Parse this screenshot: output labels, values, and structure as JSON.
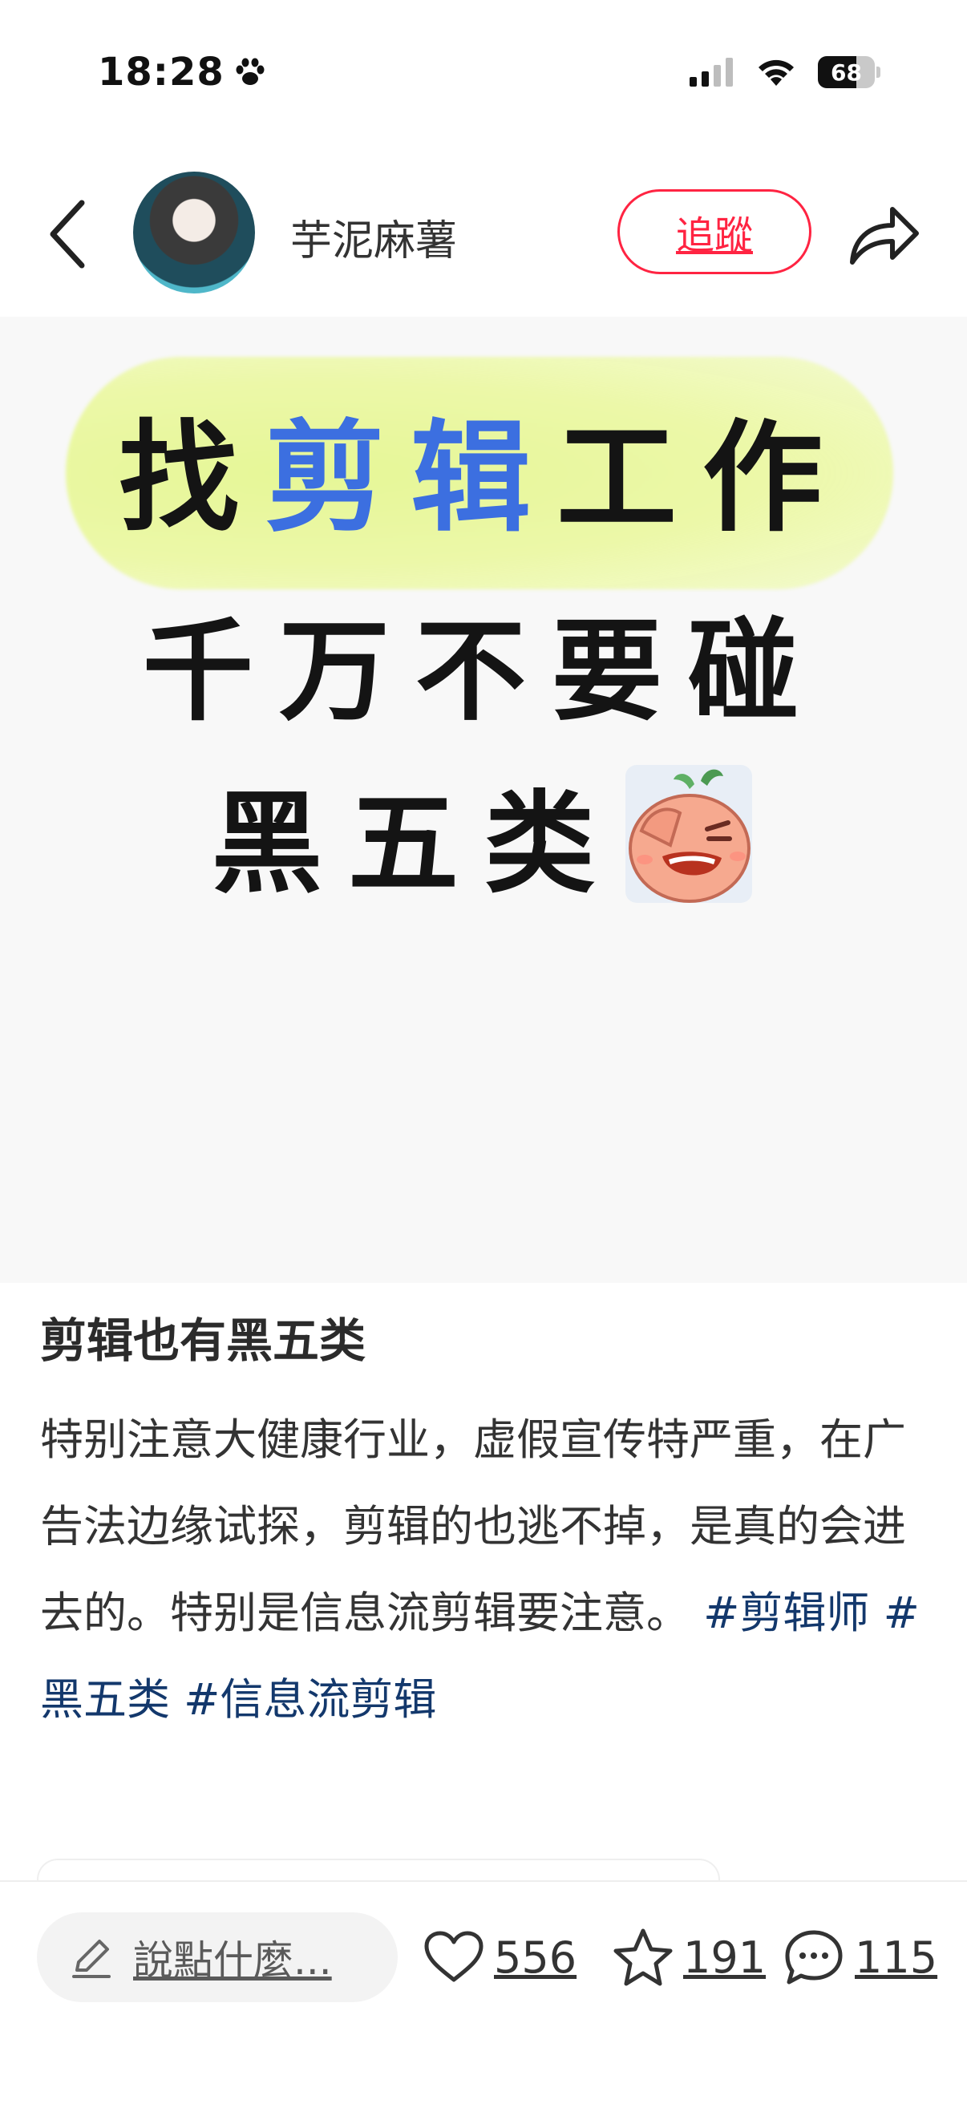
{
  "status_bar": {
    "time": "18:28",
    "battery_level": "68",
    "battery_fraction": 0.68,
    "icons": [
      "paw-icon",
      "signal-icon",
      "wifi-icon",
      "battery-icon"
    ]
  },
  "header": {
    "username": "芋泥麻薯",
    "follow_label": "追蹤",
    "icons": [
      "back-icon",
      "avatar",
      "share-icon"
    ]
  },
  "cover": {
    "line1_pre": "找",
    "line1_accent": "剪辑",
    "line1_post": "工作",
    "line2": "千万不要碰",
    "line3": "黑五类",
    "highlight_color": "#e6f797",
    "accent_color": "#3c6fe0",
    "sticker": "facepalm-sticker-icon"
  },
  "post": {
    "title": "剪辑也有黑五类",
    "body": "特别注意大健康行业，虚假宣传特严重，在广告法边缘试探，剪辑的也逃不掉，是真的会进去的。特别是信息流剪辑要注意。",
    "tags": [
      "#剪辑师",
      "#黑五类",
      "#信息流剪辑"
    ],
    "tag_color": "#13386c"
  },
  "bottom_bar": {
    "comment_placeholder": "說點什麼...",
    "like_count": "556",
    "collect_count": "191",
    "comment_count": "115",
    "icons": [
      "pencil-icon",
      "heart-icon",
      "star-icon",
      "comment-bubble-icon"
    ]
  },
  "colors": {
    "brand_red": "#ff2442",
    "background": "#ffffff",
    "cover_background": "#f8f8f8"
  }
}
